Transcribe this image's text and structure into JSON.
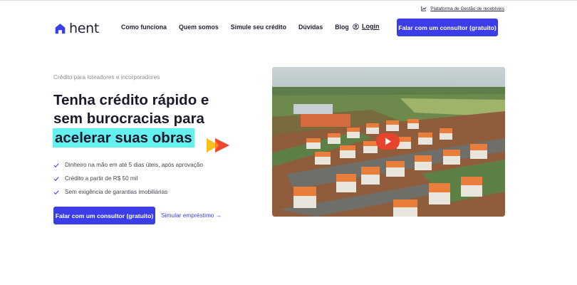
{
  "header": {
    "platform_link": "Plataforma de Gestão de recebíveis",
    "logo_text": "hent",
    "nav": [
      "Como funciona",
      "Quem somos",
      "Simule seu crédito",
      "Dúvidas",
      "Blog"
    ],
    "login": "Login",
    "cta": "Falar com um consultor (gratuito)"
  },
  "hero": {
    "eyebrow": "Crédito para loteadores e incorporadores",
    "headline_line1": "Tenha crédito rápido e",
    "headline_line2": "sem burocracias para",
    "headline_highlight": "acelerar suas obras",
    "benefits": [
      "Dinheiro na mão em até 5 dias úteis, após aprovação",
      "Crédito a partir de R$ 50 mil",
      "Sem exigência de garantias imobiliárias"
    ],
    "cta": "Falar com um consultor (gratuito)",
    "secondary_link": "Simular empréstimo →"
  },
  "colors": {
    "primary": "#3b3ee8",
    "highlight": "#63f0ef",
    "arrow_yellow": "#f6c21b",
    "arrow_red": "#f0462d",
    "play_red": "#e8432f"
  },
  "icons": {
    "logo": "house-icon",
    "platform": "chart-line-icon",
    "login": "user-circle-icon",
    "benefit": "check-icon",
    "video": "play-icon"
  }
}
